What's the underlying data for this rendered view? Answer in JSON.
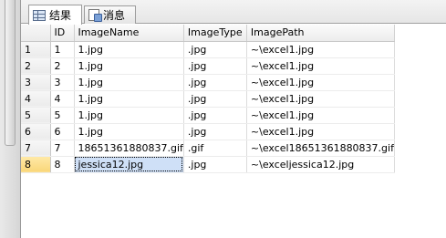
{
  "tabs": [
    {
      "label": "结果",
      "icon": "grid-icon",
      "active": true
    },
    {
      "label": "消息",
      "icon": "message-icon",
      "active": false
    }
  ],
  "table": {
    "headers": [
      "",
      "ID",
      "ImageName",
      "ImageType",
      "ImagePath"
    ],
    "rows": [
      [
        "1",
        "1",
        "1.jpg",
        ".jpg",
        "~\\excel1.jpg"
      ],
      [
        "2",
        "2",
        "1.jpg",
        ".jpg",
        "~\\excel1.jpg"
      ],
      [
        "3",
        "3",
        "1.jpg",
        ".jpg",
        "~\\excel1.jpg"
      ],
      [
        "4",
        "4",
        "1.jpg",
        ".jpg",
        "~\\excel1.jpg"
      ],
      [
        "5",
        "5",
        "1.jpg",
        ".jpg",
        "~\\excel1.jpg"
      ],
      [
        "6",
        "6",
        "1.jpg",
        ".jpg",
        "~\\excel1.jpg"
      ],
      [
        "7",
        "7",
        "18651361880837.gif",
        ".gif",
        "~\\excel18651361880837.gif"
      ],
      [
        "8",
        "8",
        "jessica12.jpg",
        ".jpg",
        "~\\exceljessica12.jpg"
      ]
    ],
    "selected_row": 8
  }
}
